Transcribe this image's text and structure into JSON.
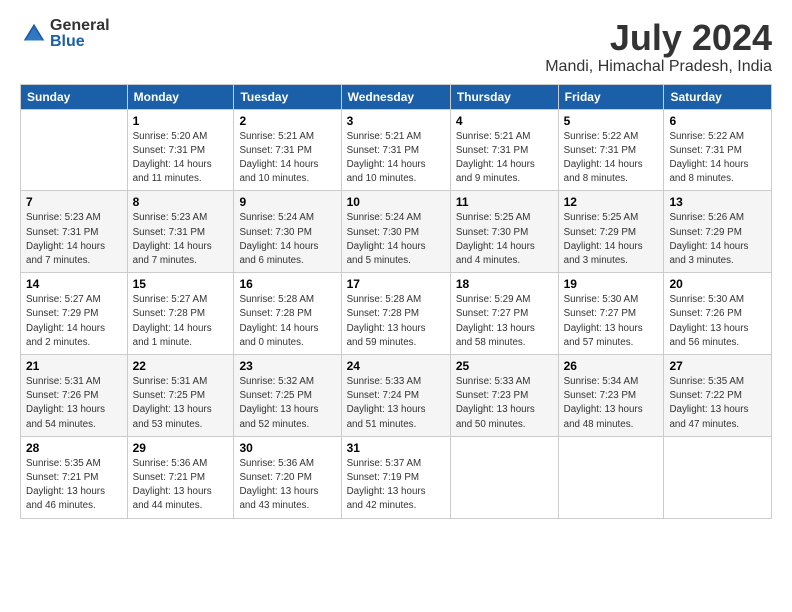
{
  "logo": {
    "general": "General",
    "blue": "Blue"
  },
  "title": "July 2024",
  "location": "Mandi, Himachal Pradesh, India",
  "headers": [
    "Sunday",
    "Monday",
    "Tuesday",
    "Wednesday",
    "Thursday",
    "Friday",
    "Saturday"
  ],
  "weeks": [
    [
      {
        "day": "",
        "info": ""
      },
      {
        "day": "1",
        "info": "Sunrise: 5:20 AM\nSunset: 7:31 PM\nDaylight: 14 hours\nand 11 minutes."
      },
      {
        "day": "2",
        "info": "Sunrise: 5:21 AM\nSunset: 7:31 PM\nDaylight: 14 hours\nand 10 minutes."
      },
      {
        "day": "3",
        "info": "Sunrise: 5:21 AM\nSunset: 7:31 PM\nDaylight: 14 hours\nand 10 minutes."
      },
      {
        "day": "4",
        "info": "Sunrise: 5:21 AM\nSunset: 7:31 PM\nDaylight: 14 hours\nand 9 minutes."
      },
      {
        "day": "5",
        "info": "Sunrise: 5:22 AM\nSunset: 7:31 PM\nDaylight: 14 hours\nand 8 minutes."
      },
      {
        "day": "6",
        "info": "Sunrise: 5:22 AM\nSunset: 7:31 PM\nDaylight: 14 hours\nand 8 minutes."
      }
    ],
    [
      {
        "day": "7",
        "info": "Sunrise: 5:23 AM\nSunset: 7:31 PM\nDaylight: 14 hours\nand 7 minutes."
      },
      {
        "day": "8",
        "info": "Sunrise: 5:23 AM\nSunset: 7:31 PM\nDaylight: 14 hours\nand 7 minutes."
      },
      {
        "day": "9",
        "info": "Sunrise: 5:24 AM\nSunset: 7:30 PM\nDaylight: 14 hours\nand 6 minutes."
      },
      {
        "day": "10",
        "info": "Sunrise: 5:24 AM\nSunset: 7:30 PM\nDaylight: 14 hours\nand 5 minutes."
      },
      {
        "day": "11",
        "info": "Sunrise: 5:25 AM\nSunset: 7:30 PM\nDaylight: 14 hours\nand 4 minutes."
      },
      {
        "day": "12",
        "info": "Sunrise: 5:25 AM\nSunset: 7:29 PM\nDaylight: 14 hours\nand 3 minutes."
      },
      {
        "day": "13",
        "info": "Sunrise: 5:26 AM\nSunset: 7:29 PM\nDaylight: 14 hours\nand 3 minutes."
      }
    ],
    [
      {
        "day": "14",
        "info": "Sunrise: 5:27 AM\nSunset: 7:29 PM\nDaylight: 14 hours\nand 2 minutes."
      },
      {
        "day": "15",
        "info": "Sunrise: 5:27 AM\nSunset: 7:28 PM\nDaylight: 14 hours\nand 1 minute."
      },
      {
        "day": "16",
        "info": "Sunrise: 5:28 AM\nSunset: 7:28 PM\nDaylight: 14 hours\nand 0 minutes."
      },
      {
        "day": "17",
        "info": "Sunrise: 5:28 AM\nSunset: 7:28 PM\nDaylight: 13 hours\nand 59 minutes."
      },
      {
        "day": "18",
        "info": "Sunrise: 5:29 AM\nSunset: 7:27 PM\nDaylight: 13 hours\nand 58 minutes."
      },
      {
        "day": "19",
        "info": "Sunrise: 5:30 AM\nSunset: 7:27 PM\nDaylight: 13 hours\nand 57 minutes."
      },
      {
        "day": "20",
        "info": "Sunrise: 5:30 AM\nSunset: 7:26 PM\nDaylight: 13 hours\nand 56 minutes."
      }
    ],
    [
      {
        "day": "21",
        "info": "Sunrise: 5:31 AM\nSunset: 7:26 PM\nDaylight: 13 hours\nand 54 minutes."
      },
      {
        "day": "22",
        "info": "Sunrise: 5:31 AM\nSunset: 7:25 PM\nDaylight: 13 hours\nand 53 minutes."
      },
      {
        "day": "23",
        "info": "Sunrise: 5:32 AM\nSunset: 7:25 PM\nDaylight: 13 hours\nand 52 minutes."
      },
      {
        "day": "24",
        "info": "Sunrise: 5:33 AM\nSunset: 7:24 PM\nDaylight: 13 hours\nand 51 minutes."
      },
      {
        "day": "25",
        "info": "Sunrise: 5:33 AM\nSunset: 7:23 PM\nDaylight: 13 hours\nand 50 minutes."
      },
      {
        "day": "26",
        "info": "Sunrise: 5:34 AM\nSunset: 7:23 PM\nDaylight: 13 hours\nand 48 minutes."
      },
      {
        "day": "27",
        "info": "Sunrise: 5:35 AM\nSunset: 7:22 PM\nDaylight: 13 hours\nand 47 minutes."
      }
    ],
    [
      {
        "day": "28",
        "info": "Sunrise: 5:35 AM\nSunset: 7:21 PM\nDaylight: 13 hours\nand 46 minutes."
      },
      {
        "day": "29",
        "info": "Sunrise: 5:36 AM\nSunset: 7:21 PM\nDaylight: 13 hours\nand 44 minutes."
      },
      {
        "day": "30",
        "info": "Sunrise: 5:36 AM\nSunset: 7:20 PM\nDaylight: 13 hours\nand 43 minutes."
      },
      {
        "day": "31",
        "info": "Sunrise: 5:37 AM\nSunset: 7:19 PM\nDaylight: 13 hours\nand 42 minutes."
      },
      {
        "day": "",
        "info": ""
      },
      {
        "day": "",
        "info": ""
      },
      {
        "day": "",
        "info": ""
      }
    ]
  ]
}
